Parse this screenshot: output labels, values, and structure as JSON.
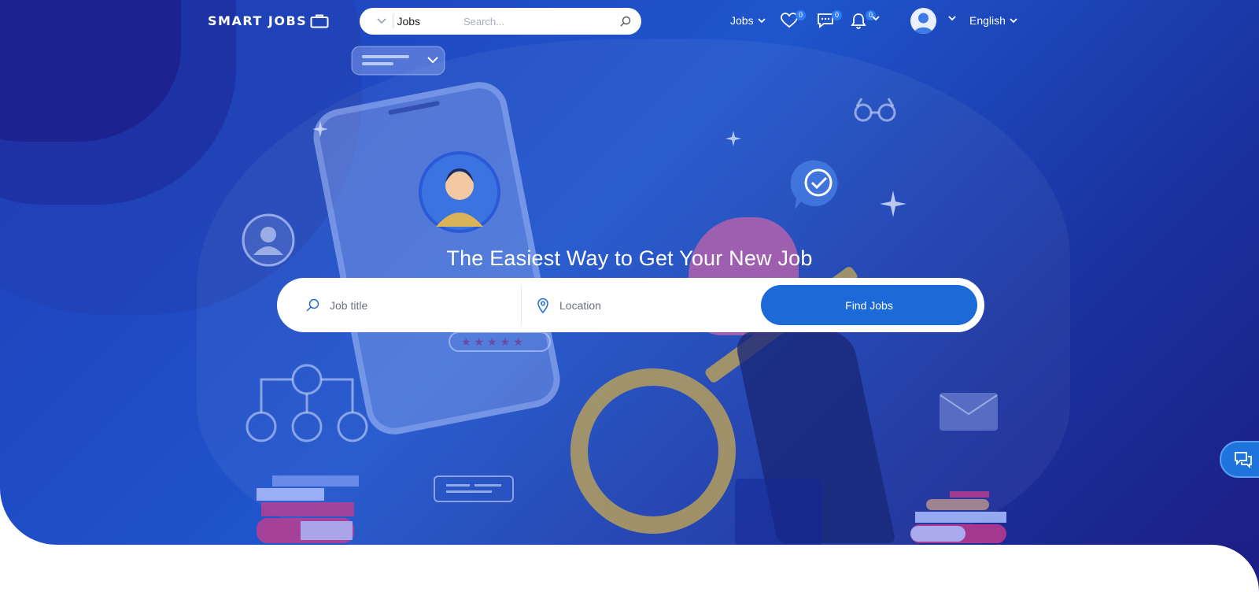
{
  "header": {
    "logo_text": "SMART JOBS",
    "search": {
      "category": "Jobs",
      "placeholder": "Search..."
    },
    "nav_jobs_label": "Jobs",
    "favorites_count": "0",
    "messages_count": "0",
    "notifications_count": "0",
    "language": "English"
  },
  "hero": {
    "headline": "The Easiest Way to Get Your New Job",
    "job_title_placeholder": "Job title",
    "location_placeholder": "Location",
    "find_button": "Find Jobs"
  },
  "icons": {
    "logo": "briefcase-icon",
    "category_toggle": "chevron-down-icon",
    "search": "search-icon",
    "favorites": "heart-icon",
    "messages": "chat-icon",
    "notifications": "bell-icon",
    "user": "avatar-icon",
    "location": "map-pin-icon",
    "floating_chat": "chat-bubbles-icon"
  },
  "colors": {
    "primary": "#1b6ad8",
    "hero_dark": "#1c1f86",
    "hero_mid": "#1f55cc",
    "badge": "#2f7cf6",
    "white": "#ffffff"
  }
}
